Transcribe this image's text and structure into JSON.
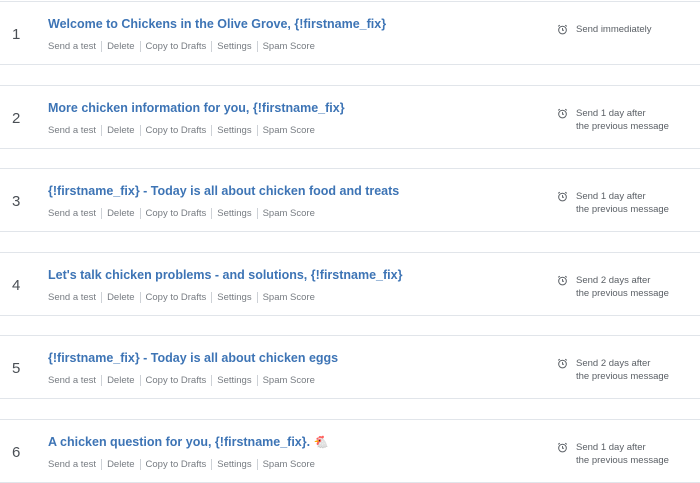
{
  "actions": {
    "send_test": "Send a test",
    "delete": "Delete",
    "copy_to_drafts": "Copy to Drafts",
    "settings": "Settings",
    "spam_score": "Spam Score"
  },
  "emails": [
    {
      "number": "1",
      "subject": "Welcome to Chickens in the Olive Grove, {!firstname_fix}",
      "schedule_line1": "Send immediately",
      "schedule_line2": ""
    },
    {
      "number": "2",
      "subject": "More chicken information for you, {!firstname_fix}",
      "schedule_line1": "Send 1 day after",
      "schedule_line2": "the previous message"
    },
    {
      "number": "3",
      "subject": "{!firstname_fix} - Today is all about chicken food and treats",
      "schedule_line1": "Send 1 day after",
      "schedule_line2": "the previous message"
    },
    {
      "number": "4",
      "subject": "Let's talk chicken problems - and solutions, {!firstname_fix}",
      "schedule_line1": "Send 2 days after",
      "schedule_line2": "the previous message"
    },
    {
      "number": "5",
      "subject": "{!firstname_fix} - Today is all about chicken eggs",
      "schedule_line1": "Send 2 days after",
      "schedule_line2": "the previous message"
    },
    {
      "number": "6",
      "subject": "A chicken question for you, {!firstname_fix}.",
      "subject_emoji": "🐔",
      "schedule_line1": "Send 1 day after",
      "schedule_line2": "the previous message"
    }
  ],
  "icons": {
    "schedule": "alarm-clock-icon"
  },
  "colors": {
    "link": "#3d74b5",
    "muted": "#777c82",
    "divider": "#e1e5ea"
  }
}
